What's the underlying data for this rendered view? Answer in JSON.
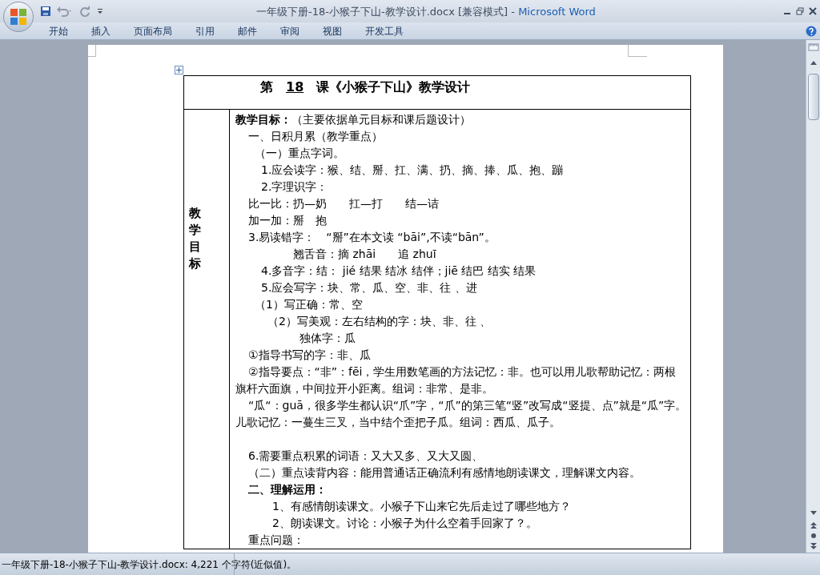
{
  "window": {
    "document_title": "一年级下册-18-小猴子下山-教学设计.docx [兼容模式]",
    "separator": " - ",
    "app_name": "Microsoft Word"
  },
  "ribbon_tabs": [
    {
      "label": "开始",
      "selected": false
    },
    {
      "label": "插入",
      "selected": false
    },
    {
      "label": "页面布局",
      "selected": false
    },
    {
      "label": "引用",
      "selected": false
    },
    {
      "label": "邮件",
      "selected": false
    },
    {
      "label": "审阅",
      "selected": false
    },
    {
      "label": "视图",
      "selected": false
    },
    {
      "label": "开发工具",
      "selected": false
    }
  ],
  "document": {
    "title": {
      "prefix": "第",
      "number": "18",
      "suffix": "课《小猴子下山》教学设计"
    },
    "side_label": "教学目标",
    "lines": [
      {
        "kind": "lead",
        "text": "**教学目标：**（主要依据单元目标和课后题设计）"
      },
      {
        "kind": "body",
        "text": "一、日积月累（教学重点）"
      },
      {
        "kind": "sub",
        "text": "（一）重点字词。"
      },
      {
        "kind": "item",
        "text": "1.应会读字：猴、结、掰、扛、满、扔、摘、捧、瓜、抱、蹦"
      },
      {
        "kind": "item",
        "text": "2.字理识字："
      },
      {
        "kind": "body",
        "text": "比一比：扔—奶　　扛—打　　结—诘"
      },
      {
        "kind": "body",
        "text": "加一加：掰　抱"
      },
      {
        "kind": "body",
        "text": "3.易读错字：　“掰”在本文读 “bāi”,不读“bān”。"
      },
      {
        "kind": "pinyin",
        "text": "翘舌音：摘 zhāi　　追 zhuī"
      },
      {
        "kind": "item",
        "text": "4.多音字：结： jié 结果 结冰 结伴；jiē 结巴 结实 结果"
      },
      {
        "kind": "item",
        "text": "5.应会写字：块、常、瓜、空、非、往 、进"
      },
      {
        "kind": "sub",
        "text": "（1）写正确：常、空"
      },
      {
        "kind": "detail",
        "text": "（2）写美观：左右结构的字：块、非、往 、"
      },
      {
        "kind": "aside",
        "text": "独体字：瓜"
      },
      {
        "kind": "body",
        "text": "①指导书写的字：非、瓜"
      },
      {
        "kind": "body",
        "text": "②指导要点：“非”：fēi，学生用数笔画的方法记忆：非。也可以用儿歌帮助记忆：两根旗杆六面旗，中间拉开小距离。组词：非常、是非。"
      },
      {
        "kind": "body",
        "text": "“瓜“：guā，很多学生都认识“爪”字，“爪”的第三笔“竖”改写成“竖提、点”就是“瓜”字。儿歌记忆：一蔓生三叉，当中结个歪把子瓜。组词：西瓜、瓜子。"
      },
      {
        "kind": "blank"
      },
      {
        "kind": "body",
        "text": "6.需要重点积累的词语：又大又多、又大又圆、"
      },
      {
        "kind": "body",
        "text": "（二）重点读背内容：能用普通话正确流利有感情地朗读课文，理解课文内容。"
      },
      {
        "kind": "body",
        "text": "**二、理解运用：**"
      },
      {
        "kind": "item",
        "text": "　1、有感情朗读课文。小猴子下山来它先后走过了哪些地方？"
      },
      {
        "kind": "item",
        "text": "　2、朗读课文。讨论：小猴子为什么空着手回家了？。"
      },
      {
        "kind": "body",
        "text": "重点问题："
      }
    ]
  },
  "status_bar": {
    "text": "一年级下册-18-小猴子下山-教学设计.docx: 4,221 个字符(近似值)。"
  }
}
